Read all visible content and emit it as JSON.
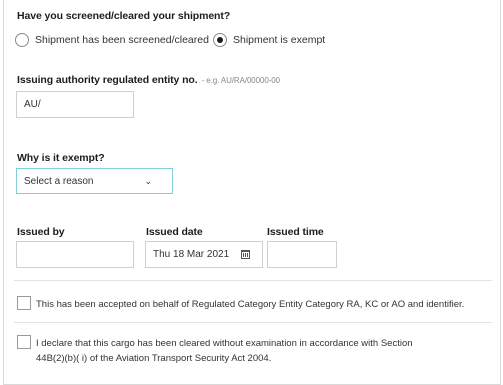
{
  "screening": {
    "question": "Have you screened/cleared your shipment?",
    "options": [
      {
        "label": "Shipment has been screened/cleared",
        "selected": false
      },
      {
        "label": "Shipment is exempt",
        "selected": true
      }
    ]
  },
  "entity": {
    "label": "Issuing authority regulated entity no.",
    "hint": "- e.g. AU/RA/00000-00",
    "value": "AU/"
  },
  "exempt": {
    "label": "Why is it exempt?",
    "select_value": "Select a reason"
  },
  "issued": {
    "by_label": "Issued by",
    "by_value": "",
    "date_label": "Issued date",
    "date_value": "Thu 18 Mar 2021",
    "time_label": "Issued time",
    "time_value": ""
  },
  "checkboxes": [
    {
      "text": "This has been accepted on behalf of Regulated Category Entity Category RA, KC or AO and identifier.",
      "checked": false
    },
    {
      "text": "I declare that this cargo has been cleared without examination in accordance with Section 44B(2)(b)( i) of the Aviation Transport Security Act 2004.",
      "checked": false
    }
  ],
  "colors": {
    "select_border": "#7fd0d8",
    "text": "#1f1f1f"
  }
}
